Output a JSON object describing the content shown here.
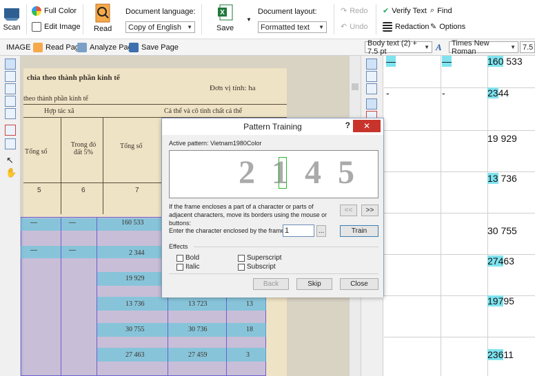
{
  "ribbon": {
    "scan": "Scan",
    "full_color": "Full Color",
    "edit_image": "Edit Image",
    "read": "Read",
    "doc_language_label": "Document language:",
    "doc_language_value": "Copy of English",
    "save": "Save",
    "doc_layout_label": "Document layout:",
    "doc_layout_value": "Formatted text",
    "redo": "Redo",
    "undo": "Undo",
    "verify_text": "Verify Text",
    "redaction": "Redaction",
    "find": "Find",
    "options": "Options"
  },
  "toolbar": {
    "image_label": "IMAGE",
    "read_page": "Read Page",
    "analyze_page": "Analyze Page",
    "save_page": "Save Page",
    "style_value": "Body text (2) + 7.5 pt",
    "font_value": "Times New Roman",
    "size_value": "7.5"
  },
  "image_pane": {
    "line1": "chia theo thành phần kinh tế",
    "unit": "Đơn vị tính: ha",
    "line2": "theo thành phần kinh tế",
    "col_htx": "Hợp tác xã",
    "col_cathe": "Cá thể và cô tình chất cá thể",
    "col_tongso": "Tổng số",
    "col_trongdo": "Trong đó đất 5%",
    "col_tongso2": "Tổng số",
    "num5": "5",
    "num6": "6",
    "num7": "7",
    "rows": [
      {
        "a": "—",
        "b": "—",
        "c": "160 533",
        "d": "",
        "e": ""
      },
      {
        "a": "—",
        "b": "—",
        "c": "2 344",
        "d": "",
        "e": ""
      },
      {
        "a": "",
        "b": "",
        "c": "19 929",
        "d": "",
        "e": ""
      },
      {
        "a": "",
        "b": "",
        "c": "13 736",
        "d": "13 723",
        "e": "13"
      },
      {
        "a": "",
        "b": "",
        "c": "30 755",
        "d": "30 736",
        "e": "18"
      },
      {
        "a": "",
        "b": "",
        "c": "27 463",
        "d": "27 459",
        "e": "3"
      }
    ]
  },
  "text_pane": {
    "rows": [
      {
        "a": "—",
        "b": "—",
        "hl": "160",
        "rest": " 533"
      },
      {
        "a": "-",
        "b": "-",
        "hl": "23",
        "rest": "44"
      },
      {
        "a": "",
        "b": "",
        "hl": "",
        "rest": "19 929"
      },
      {
        "a": "",
        "b": "",
        "hl": "13",
        "rest": " 736"
      },
      {
        "a": "",
        "b": "",
        "hl": "",
        "rest": "30 755"
      },
      {
        "a": "",
        "b": "",
        "hl": "274",
        "rest": "63"
      },
      {
        "a": "",
        "b": "",
        "hl": "197",
        "rest": "95"
      },
      {
        "a": "",
        "b": "",
        "hl": "236",
        "rest": "11"
      }
    ]
  },
  "dialog": {
    "title": "Pattern Training",
    "help": "?",
    "close": "✕",
    "active_pattern_label": "Active pattern:",
    "active_pattern_value": "Vietnam1980Color",
    "glyphs": "2 1 4 5",
    "hint": "If the frame encloses a part of a character or parts of adjacent characters, move its borders using the mouse or buttons:",
    "prev": "<<",
    "next": ">>",
    "enter_label": "Enter the character enclosed by the frame:",
    "enter_value": "1",
    "more": "...",
    "train": "Train",
    "effects_label": "Effects",
    "bold": "Bold",
    "italic": "Italic",
    "superscript": "Superscript",
    "subscript": "Subscript",
    "back": "Back",
    "skip": "Skip",
    "close_btn": "Close"
  }
}
